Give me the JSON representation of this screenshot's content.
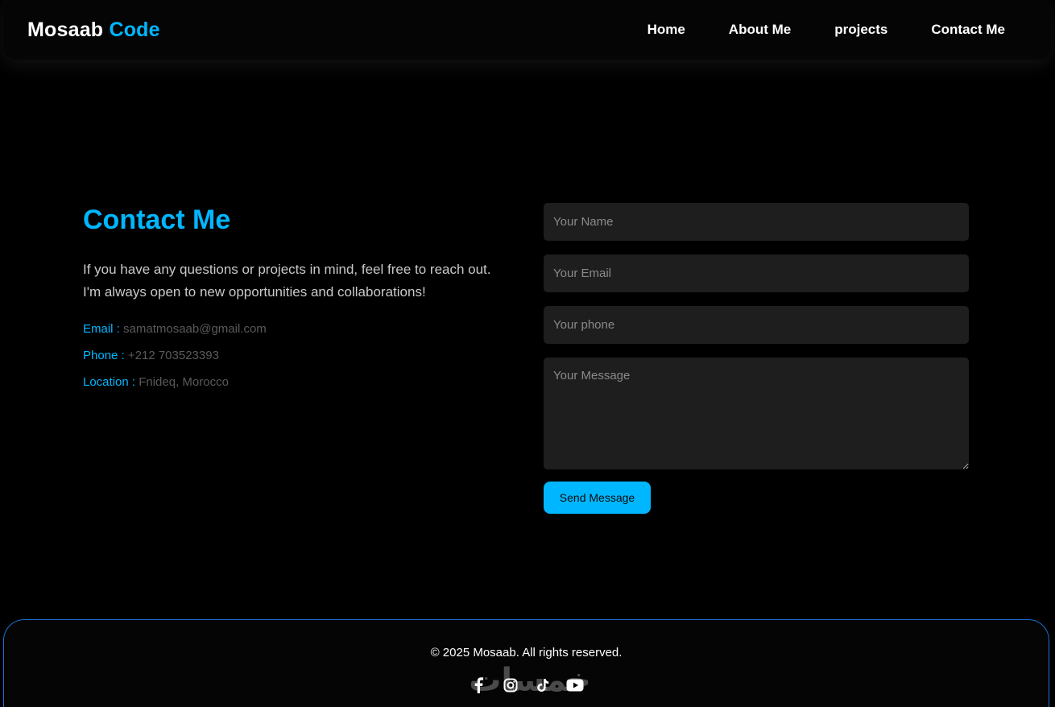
{
  "header": {
    "logo_primary": "Mosaab",
    "logo_accent": "Code",
    "nav": [
      "Home",
      "About Me",
      "projects",
      "Contact Me"
    ]
  },
  "contact": {
    "title": "Contact Me",
    "description": "If you have any questions or projects in mind, feel free to reach out. I'm always open to new opportunities and collaborations!",
    "email_label": "Email :",
    "email_value": "samatmosaab@gmail.com",
    "phone_label": "Phone :",
    "phone_value": "+212 703523393",
    "location_label": "Location :",
    "location_value": "Fnideq, Morocco"
  },
  "form": {
    "name_placeholder": "Your Name",
    "email_placeholder": "Your Email",
    "phone_placeholder": "Your phone",
    "message_placeholder": "Your Message",
    "submit_label": "Send Message"
  },
  "footer": {
    "copyright": "© 2025 Mosaab. All rights reserved.",
    "socials": [
      "facebook-icon",
      "instagram-icon",
      "tiktok-icon",
      "youtube-icon"
    ],
    "watermark": "خمسات"
  },
  "colors": {
    "accent": "#00b7ff",
    "background": "#000000",
    "field_bg": "#1e1e1e",
    "footer_border": "#1c6fd1"
  }
}
